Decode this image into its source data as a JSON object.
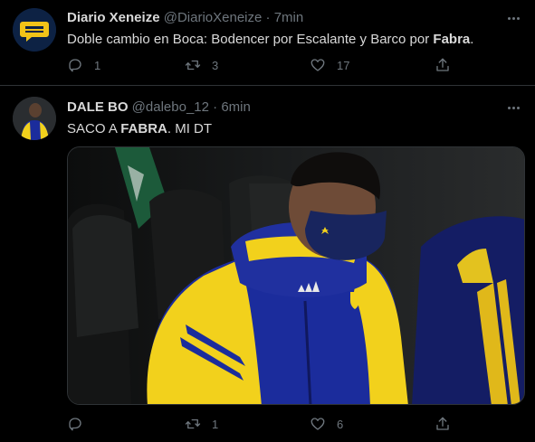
{
  "tweets": [
    {
      "display_name": "Diario Xeneize",
      "handle": "@DiarioXeneize",
      "dot": "·",
      "time": "7min",
      "text_pre": "Doble cambio en Boca: Bodencer por Escalante y Barco por ",
      "text_bold": "Fabra",
      "text_post": ".",
      "replies": "1",
      "retweets": "3",
      "likes": "17"
    },
    {
      "display_name": "DALE BO",
      "handle": "@dalebo_12",
      "dot": "·",
      "time": "6min",
      "text_pre": "SACO A ",
      "text_bold": "FABRA",
      "text_post": ". MI DT",
      "replies": "",
      "retweets": "1",
      "likes": "6"
    }
  ],
  "icons": {
    "avatar_1": "yellow-chat-bubble-logo-icon",
    "more": "more-horizontal-icon",
    "reply": "reply-bubble-icon",
    "retweet": "retweet-icon",
    "like": "heart-icon",
    "share": "share-upload-icon"
  },
  "colors": {
    "background": "#000000",
    "text": "#d9d9d9",
    "muted": "#6e767d",
    "divider": "#2f3336",
    "boca_blue": "#1b2c9c",
    "boca_yellow": "#f2d11c"
  }
}
